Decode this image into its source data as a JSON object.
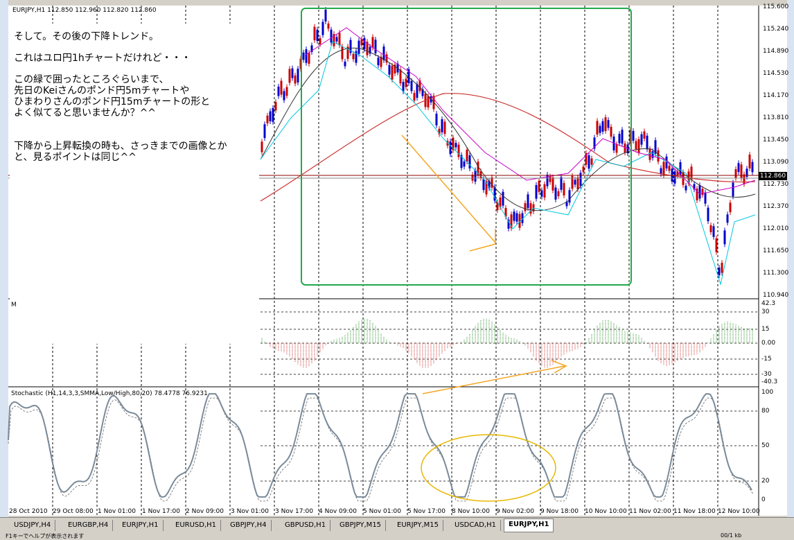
{
  "window": {
    "symbol_header": "EURJPY,H1  112.850 112.960 112.820 112.860",
    "current_price": "112.860"
  },
  "price_scale": [
    "115.600",
    "115.240",
    "114.890",
    "114.530",
    "114.170",
    "113.810",
    "113.450",
    "113.090",
    "112.730",
    "112.370",
    "112.010",
    "111.650",
    "111.300",
    "110.940"
  ],
  "osc_scale": [
    "42.3",
    "30",
    "15",
    "0.00",
    "-15",
    "-30",
    "-40.3"
  ],
  "stoch_header": "Stochastic (H1,14,3,3,SMMA,Low/High,80,20) 78.4778 76.9231",
  "stoch_scale": [
    "100",
    "80",
    "50",
    "20",
    "0"
  ],
  "osc_label": "M",
  "time_axis": [
    "28 Oct 2010",
    "29 Oct 08:00",
    "1 Nov 01:00",
    "1 Nov 17:00",
    "2 Nov 09:00",
    "3 Nov 01:00",
    "3 Nov 17:00",
    "4 Nov 09:00",
    "5 Nov 01:00",
    "5 Nov 17:00",
    "8 Nov 10:00",
    "9 Nov 02:00",
    "9 Nov 18:00",
    "10 Nov 10:00",
    "11 Nov 02:00",
    "11 Nov 18:00",
    "12 Nov 10:00"
  ],
  "annotation": {
    "line1": "そして。その後の下降トレンド。",
    "line2": "これはユロ円1hチャートだけれど・・・",
    "line3": "この緑で囲ったところぐらいまで、",
    "line4": "先日のKeiさんのポンド円5mチャートや",
    "line5": "ひまわりさんのポンド円15mチャートの形と",
    "line6": "よく似てると思いませんか？^^",
    "line7": "下降から上昇転換の時も、さっきまでの画像とか",
    "line8": "と、見るポイントは同じ^^"
  },
  "tabs": [
    "USDJPY,H4",
    "EURGBP,H4",
    "EURJPY,H1",
    "EURUSD,H1",
    "GBPJPY,H4",
    "GBPUSD,H1",
    "GBPJPY,M15",
    "EURJPY,M15",
    "USDCAD,H1",
    "EURJPY,H1"
  ],
  "active_tab_index": 9,
  "status_text": "F1キーでヘルプが表示されます",
  "status_right": "00/1 kb",
  "colors": {
    "up_candle": "#0000cc",
    "down_candle": "#cc0000",
    "green_box": "#22a84a",
    "arrow_orange": "#f5a623",
    "stoch_green": "#1f8a1f",
    "stoch_red": "#dd0000",
    "stoch_gray": "#7a8a99"
  }
}
